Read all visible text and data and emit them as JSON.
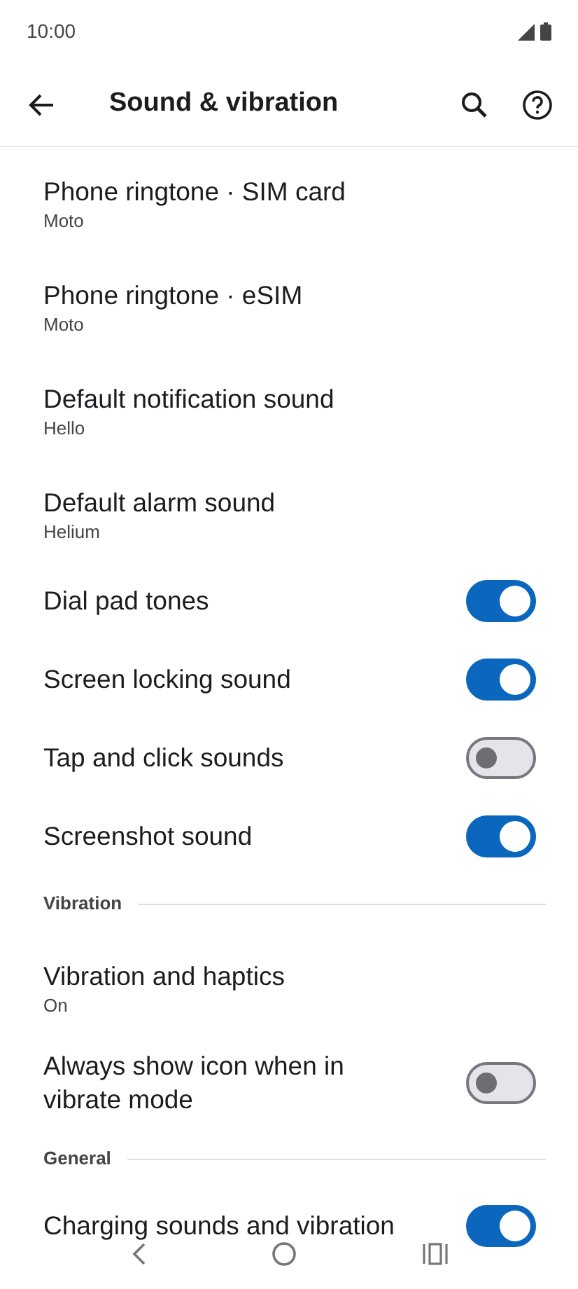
{
  "status_bar": {
    "time": "10:00"
  },
  "app_bar": {
    "title": "Sound & vibration"
  },
  "items": [
    {
      "kind": "setting",
      "title": "Phone ringtone · SIM card",
      "summary": "Moto"
    },
    {
      "kind": "setting",
      "title": "Phone ringtone · eSIM",
      "summary": "Moto"
    },
    {
      "kind": "setting",
      "title": "Default notification sound",
      "summary": "Hello"
    },
    {
      "kind": "setting",
      "title": "Default alarm sound",
      "summary": "Helium"
    },
    {
      "kind": "toggle",
      "title": "Dial pad tones",
      "on": true
    },
    {
      "kind": "toggle",
      "title": "Screen locking sound",
      "on": true
    },
    {
      "kind": "toggle",
      "title": "Tap and click sounds",
      "on": false
    },
    {
      "kind": "toggle",
      "title": "Screenshot sound",
      "on": true
    },
    {
      "kind": "header",
      "title": "Vibration"
    },
    {
      "kind": "setting",
      "title": "Vibration and haptics",
      "summary": "On"
    },
    {
      "kind": "toggle",
      "title": "Always show icon when in vibrate mode",
      "on": false
    },
    {
      "kind": "header",
      "title": "General"
    },
    {
      "kind": "toggle",
      "title": "Charging sounds and vibration",
      "on": true
    }
  ]
}
